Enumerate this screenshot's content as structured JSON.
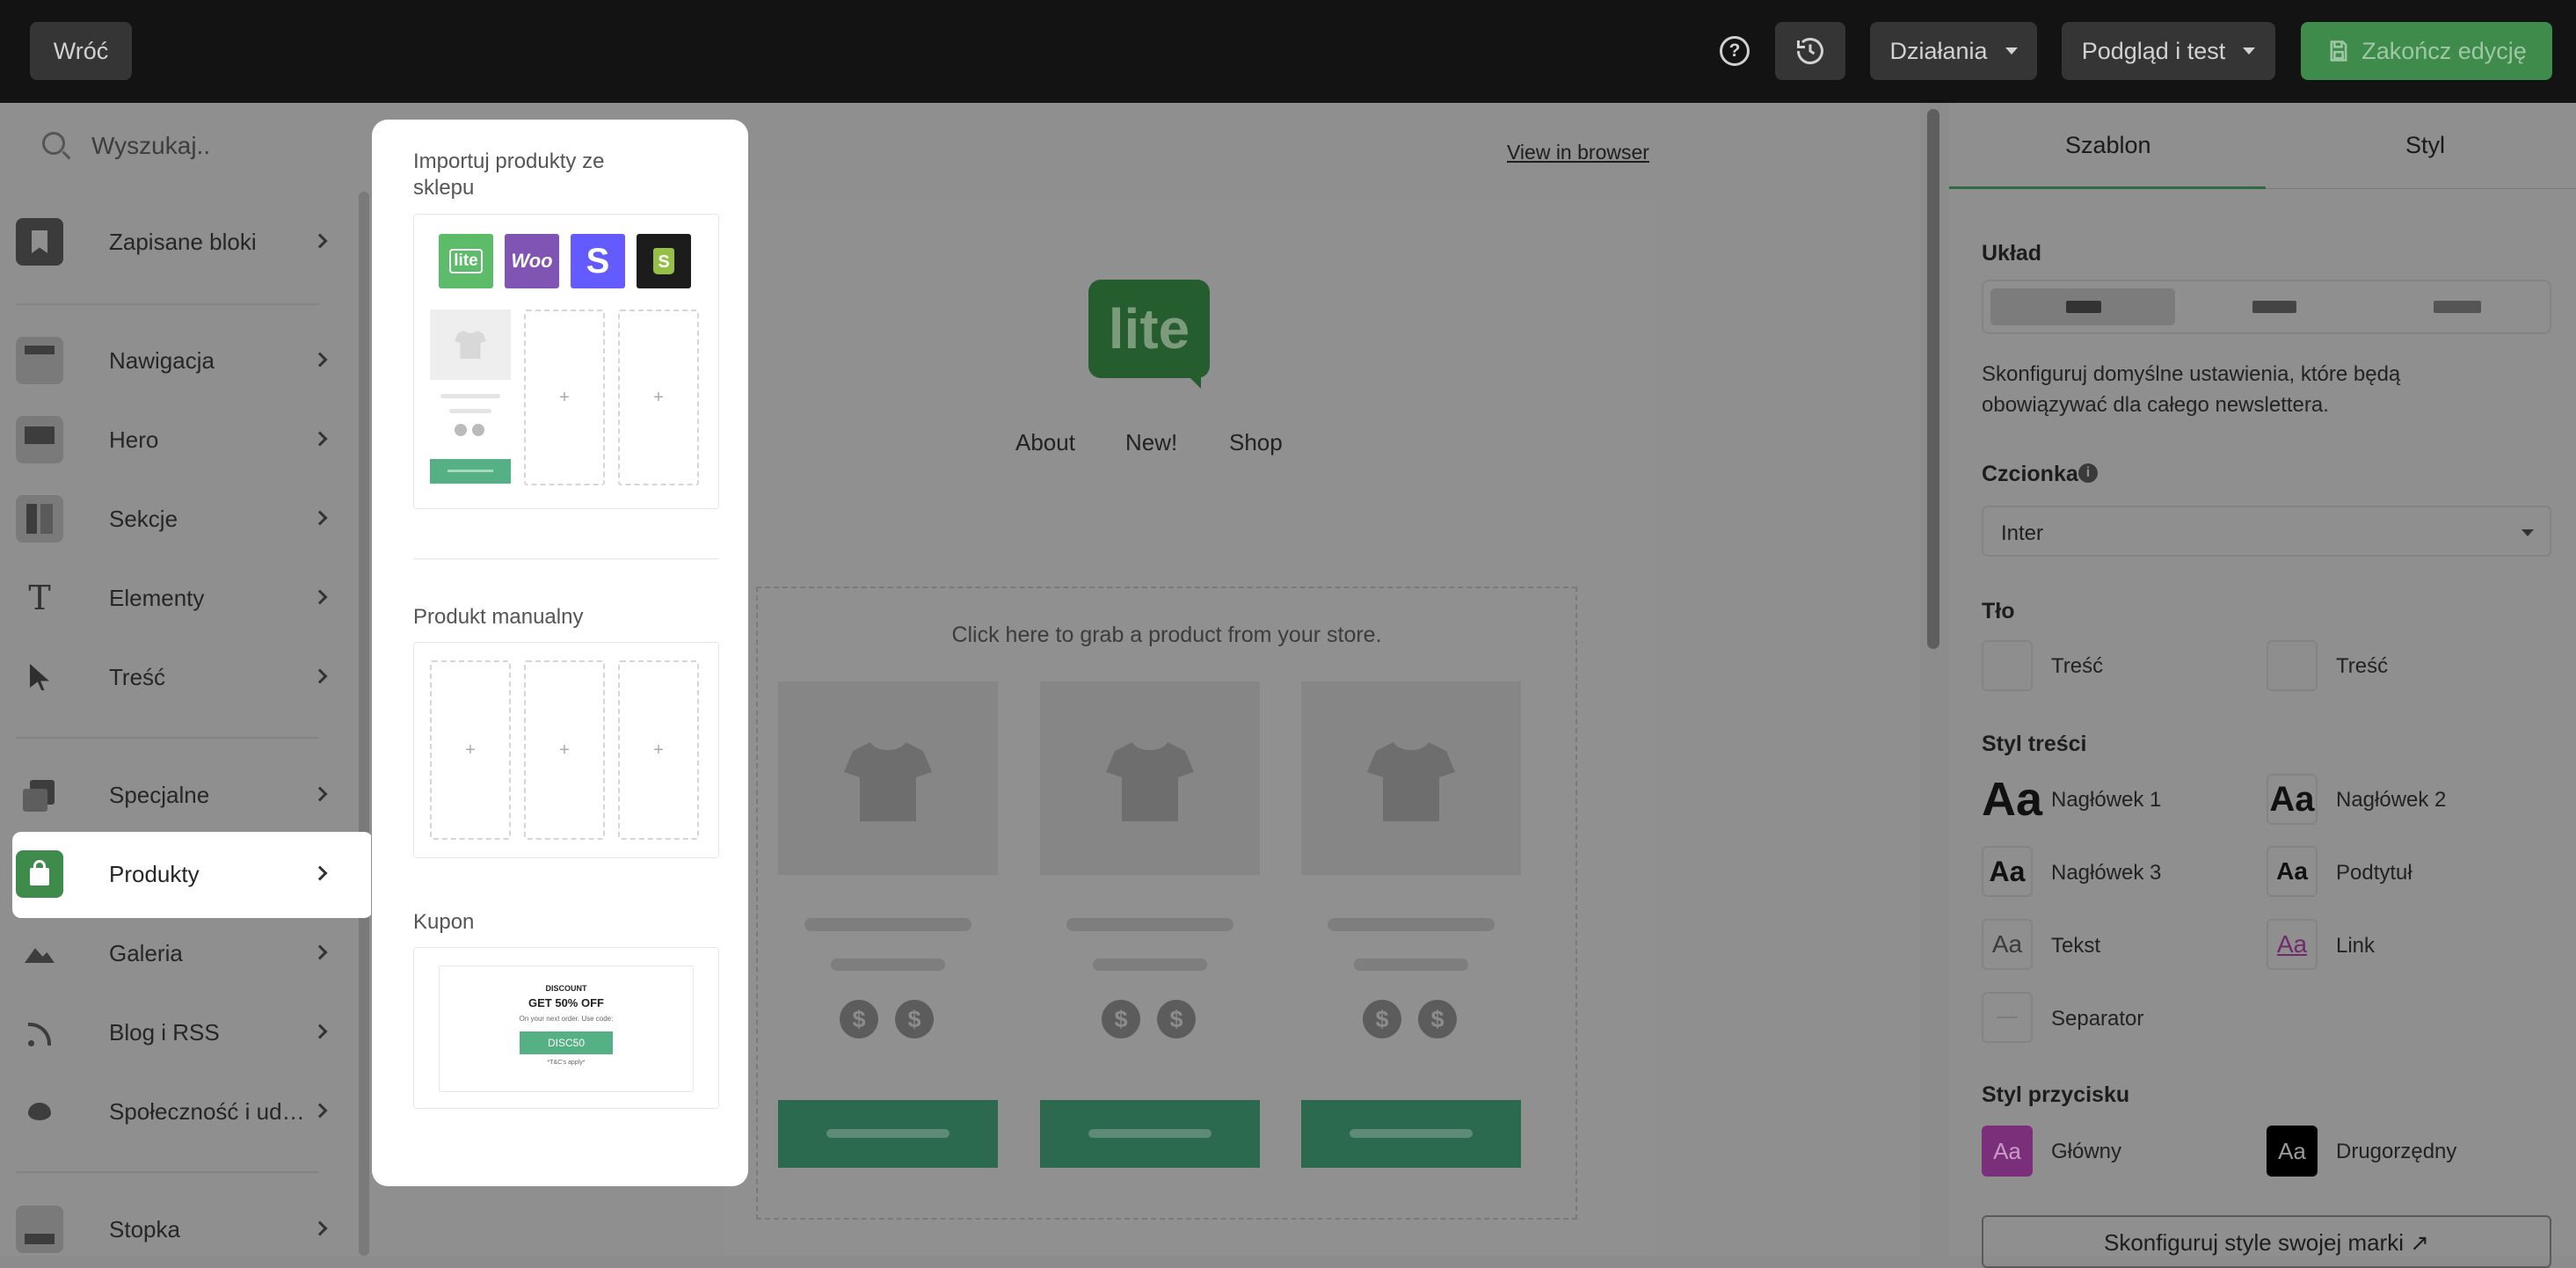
{
  "topbar": {
    "back_label": "Wróć",
    "actions_label": "Działania",
    "preview_label": "Podgląd i test",
    "finish_label": "Zakończ edycję",
    "help_icon": "question-circle-icon",
    "history_icon": "history-icon",
    "finish_icon": "save-icon",
    "finish_color": "#3f8b4c"
  },
  "sidebar": {
    "search_placeholder": "Wyszukaj..",
    "items": [
      {
        "label": "Zapisane bloki",
        "icon": "bookmark-icon"
      },
      {
        "label": "Nawigacja",
        "icon": "navigation-icon"
      },
      {
        "label": "Hero",
        "icon": "hero-icon"
      },
      {
        "label": "Sekcje",
        "icon": "sections-icon"
      },
      {
        "label": "Elementy",
        "icon": "text-t-icon"
      },
      {
        "label": "Treść",
        "icon": "cursor-icon"
      },
      {
        "label": "Specjalne",
        "icon": "special-icon"
      },
      {
        "label": "Produkty",
        "icon": "shopping-bag-icon"
      },
      {
        "label": "Galeria",
        "icon": "image-icon"
      },
      {
        "label": "Blog i RSS",
        "icon": "rss-icon"
      },
      {
        "label": "Społeczność i udostępnianie",
        "icon": "twitter-icon"
      },
      {
        "label": "Stopka",
        "icon": "footer-icon"
      }
    ],
    "active_item": "Produkty",
    "active_color": "#3f8b4c"
  },
  "products_panel": {
    "import_title": "Importuj produkty ze sklepu",
    "platforms": [
      {
        "name": "lite",
        "icon": "lite-logo",
        "color": "#5cbc6a"
      },
      {
        "name": "Woo",
        "icon": "woo-logo",
        "color": "#7f54b3"
      },
      {
        "name": "S",
        "icon": "stripe-logo",
        "color": "#635bff"
      },
      {
        "name": "Shopify",
        "icon": "shopify-logo",
        "color": "#1c1c1c"
      }
    ],
    "manual_title": "Produkt manualny",
    "coupon_title": "Kupon",
    "coupon": {
      "kicker": "DISCOUNT",
      "headline": "GET 50% OFF",
      "subtext": "On your next order. Use code:",
      "code": "DISC50",
      "terms": "*T&C's apply*"
    }
  },
  "email": {
    "view_in_browser": "View in browser",
    "logo_text": "lite",
    "nav": [
      "About",
      "New!",
      "Shop"
    ],
    "product_hint": "Click here to grab a product from your store.",
    "product_count": 3,
    "currency_symbol": "$"
  },
  "right_panel": {
    "tabs": [
      "Szablon",
      "Styl"
    ],
    "active_tab": "Szablon",
    "layout_title": "Układ",
    "description": "Skonfiguruj domyślne ustawienia, które będą obowiązywać dla całego newslettera.",
    "font_title": "Czcionka",
    "font_value": "Inter",
    "background_title": "Tło",
    "background_items": [
      "Treść",
      "Treść"
    ],
    "content_style_title": "Styl treści",
    "sample_glyph": "Aa",
    "styles": [
      "Nagłówek 1",
      "Nagłówek 2",
      "Nagłówek 3",
      "Podtytuł",
      "Tekst",
      "Link",
      "Separator"
    ],
    "button_style_title": "Styl przycisku",
    "button_styles": [
      {
        "label": "Główny",
        "color": "#7b2f7a"
      },
      {
        "label": "Drugorzędny",
        "color": "#000000"
      }
    ],
    "brand_button": "Skonfiguruj style swojej marki ↗"
  }
}
